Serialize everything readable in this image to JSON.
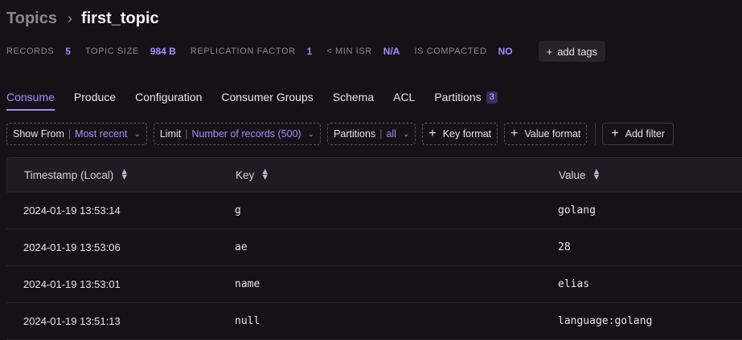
{
  "breadcrumb": {
    "root": "Topics",
    "separator": "›",
    "current": "first_topic"
  },
  "stats": [
    {
      "label": "RECORDS",
      "value": "5"
    },
    {
      "label": "TOPIC SIZE",
      "value": "984 B"
    },
    {
      "label": "REPLICATION FACTOR",
      "value": "1"
    },
    {
      "label": "< MIN ISR",
      "value": "N/A"
    },
    {
      "label": "IS COMPACTED",
      "value": "NO"
    }
  ],
  "add_tags_label": "add tags",
  "tabs": [
    {
      "label": "Consume",
      "active": true
    },
    {
      "label": "Produce"
    },
    {
      "label": "Configuration"
    },
    {
      "label": "Consumer Groups"
    },
    {
      "label": "Schema"
    },
    {
      "label": "ACL"
    },
    {
      "label": "Partitions",
      "badge": "3"
    }
  ],
  "filters": {
    "show_from": {
      "label": "Show From",
      "value": "Most recent"
    },
    "limit": {
      "label": "Limit",
      "value": "Number of records (500)"
    },
    "partitions": {
      "label": "Partitions",
      "value": "all"
    },
    "key_format": "Key format",
    "value_format": "Value format",
    "add_filter": "Add filter"
  },
  "table": {
    "columns": [
      "Timestamp (Local)",
      "Key",
      "Value"
    ],
    "rows": [
      {
        "timestamp": "2024-01-19 13:53:14",
        "key": "g",
        "value": "golang"
      },
      {
        "timestamp": "2024-01-19 13:53:06",
        "key": "ae",
        "value": "28"
      },
      {
        "timestamp": "2024-01-19 13:53:01",
        "key": "name",
        "value": "elias"
      },
      {
        "timestamp": "2024-01-19 13:51:13",
        "key": "null",
        "value": "language:golang"
      }
    ]
  },
  "colors": {
    "accent": "#a58cff",
    "background": "#141217"
  }
}
